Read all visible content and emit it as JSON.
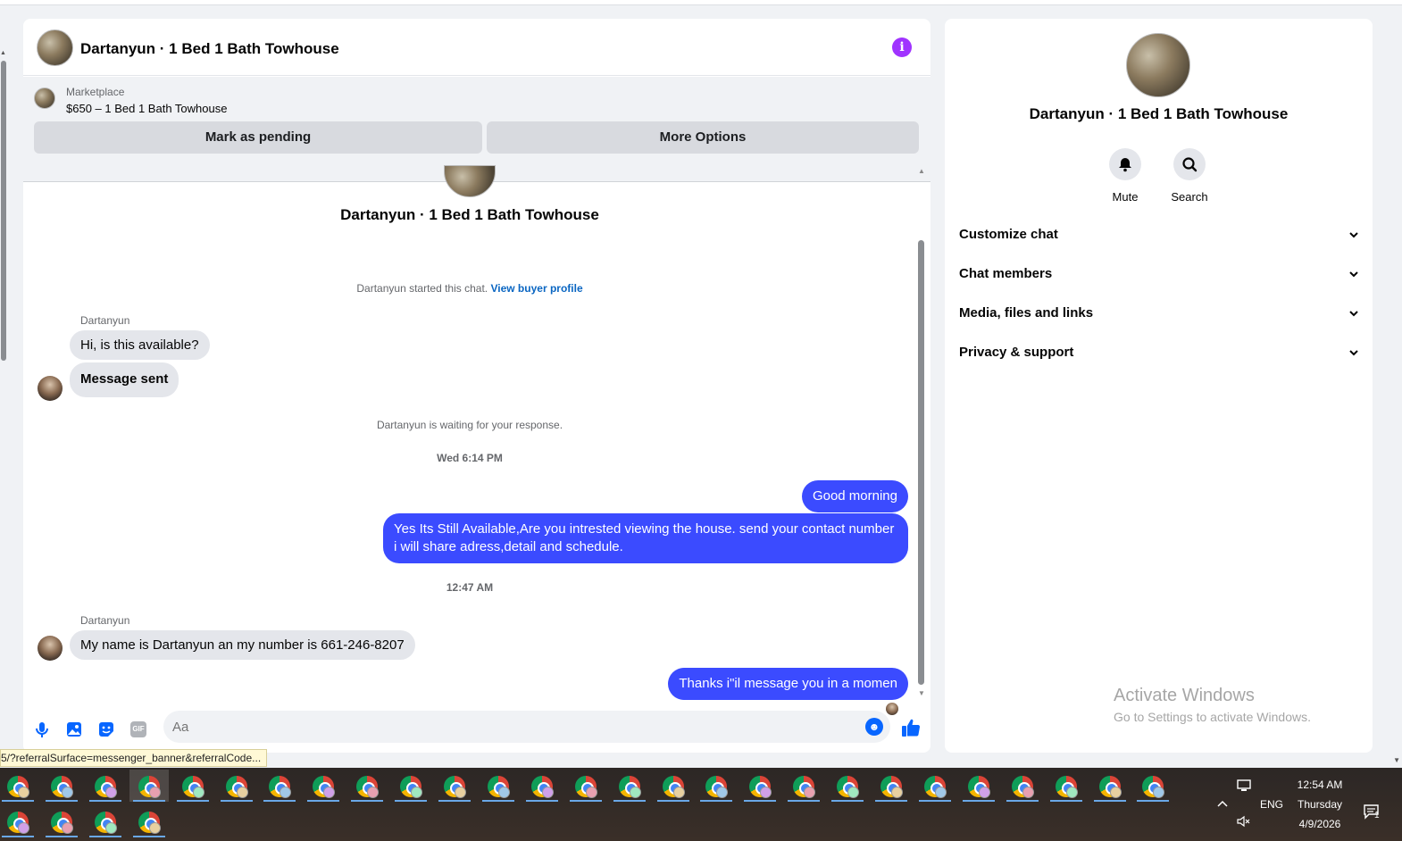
{
  "chat": {
    "title": "Dartanyun · 1 Bed 1 Bath Towhouse",
    "marketplace_label": "Marketplace",
    "item_line": "$650 – 1 Bed 1 Bath Towhouse",
    "mark_pending": "Mark as pending",
    "more_options": "More Options",
    "convo_title": "Dartanyun · 1 Bed 1 Bath Towhouse",
    "started_text": "Dartanyun started this chat.",
    "buyer_link": "View buyer profile",
    "sender_1": "Dartanyun",
    "msg_1": "Hi, is this available?",
    "msg_2": "Message sent",
    "waiting_text": "Dartanyun is waiting for your response.",
    "timestamp_1": "Wed 6:14 PM",
    "out_1": "Good morning",
    "out_2": "Yes Its Still Available,Are you intrested viewing the house. send your contact number i will share adress,detail and schedule.",
    "timestamp_2": "12:47 AM",
    "sender_2": "Dartanyun",
    "msg_3": "My name is Dartanyun  an my number is 661-246-8207",
    "out_3": "Thanks i\"il message you in a momen",
    "composer_placeholder": "Aa",
    "gif_label": "GIF"
  },
  "info_panel": {
    "title": "Dartanyun · 1 Bed 1 Bath Towhouse",
    "mute": "Mute",
    "search": "Search",
    "sections": [
      "Customize chat",
      "Chat members",
      "Media, files and links",
      "Privacy & support"
    ]
  },
  "watermark": {
    "line1": "Activate Windows",
    "line2": "Go to Settings to activate Windows."
  },
  "status_url": "5/?referralSurface=messenger_banner&referralCode...",
  "taskbar": {
    "language": "ENG",
    "time": "12:54 AM",
    "day": "Thursday",
    "date": "4/9/2026",
    "notification_count": "1"
  },
  "colors": {
    "accent": "#3b4bff",
    "messenger_blue": "#0866ff",
    "info_purple": "#a033ff"
  }
}
